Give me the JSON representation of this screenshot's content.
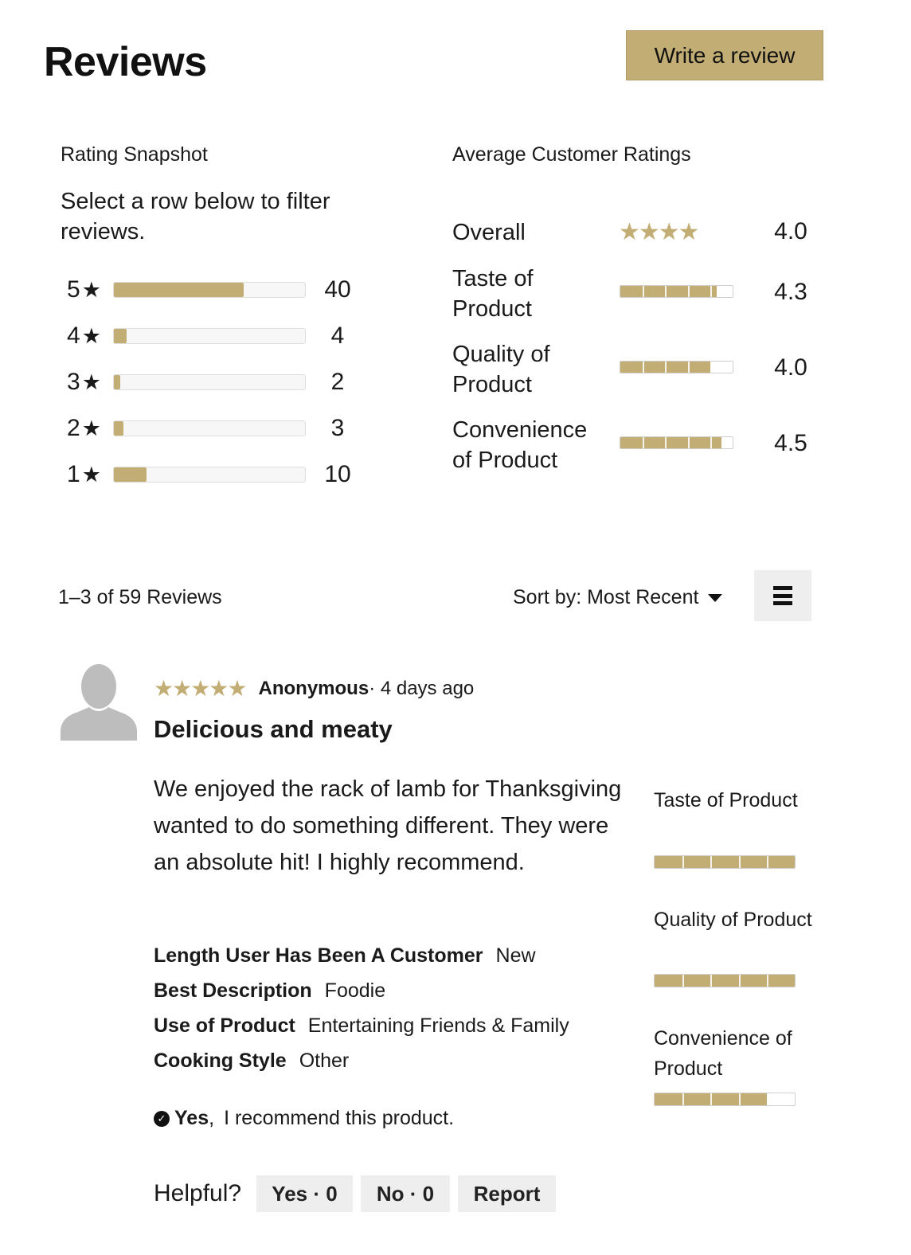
{
  "header": {
    "title": "Reviews",
    "write_review_label": "Write a review"
  },
  "snapshot": {
    "heading": "Rating Snapshot",
    "hint": "Select a row below to filter reviews.",
    "rows": [
      {
        "stars": "5",
        "count": "40",
        "fraction": 0.678
      },
      {
        "stars": "4",
        "count": "4",
        "fraction": 0.068
      },
      {
        "stars": "3",
        "count": "2",
        "fraction": 0.034
      },
      {
        "stars": "2",
        "count": "3",
        "fraction": 0.051
      },
      {
        "stars": "1",
        "count": "10",
        "fraction": 0.169
      }
    ]
  },
  "averages": {
    "heading": "Average Customer Ratings",
    "overall": {
      "label": "Overall",
      "value": "4.0",
      "stars": "★★★★"
    },
    "items": [
      {
        "label": "Taste of Product",
        "value": "4.3",
        "fraction": 0.86
      },
      {
        "label": "Quality of Product",
        "value": "4.0",
        "fraction": 0.8
      },
      {
        "label": "Convenience of Product",
        "value": "4.5",
        "fraction": 0.9
      }
    ]
  },
  "toolbar": {
    "count_text": "1–3 of 59 Reviews",
    "sort_label": "Sort by: Most Recent"
  },
  "review": {
    "stars": "★★★★★",
    "reviewer": "Anonymous",
    "date": " · 4 days ago",
    "title": "Delicious and meaty",
    "body": "We enjoyed the rack of lamb for Thanksgiving wanted to do something different. They were an absolute hit! I highly recommend.",
    "attributes": [
      {
        "key": "Length User Has Been A Customer",
        "value": "New"
      },
      {
        "key": "Best Description",
        "value": "Foodie"
      },
      {
        "key": "Use of Product",
        "value": "Entertaining Friends & Family"
      },
      {
        "key": "Cooking Style",
        "value": "Other"
      }
    ],
    "recommend_yes": "Yes",
    "recommend_text": "I recommend this product.",
    "ratings": [
      {
        "label": "Taste of Product",
        "fraction": 1.0
      },
      {
        "label": "Quality of Product",
        "fraction": 1.0
      },
      {
        "label": "Convenience of Product",
        "fraction": 0.8
      }
    ],
    "helpful_label": "Helpful?",
    "yes_label": "Yes · 0",
    "no_label": "No · 0",
    "report_label": "Report"
  },
  "colors": {
    "accent": "#c2ad74",
    "button_bg": "#eeeeee"
  }
}
